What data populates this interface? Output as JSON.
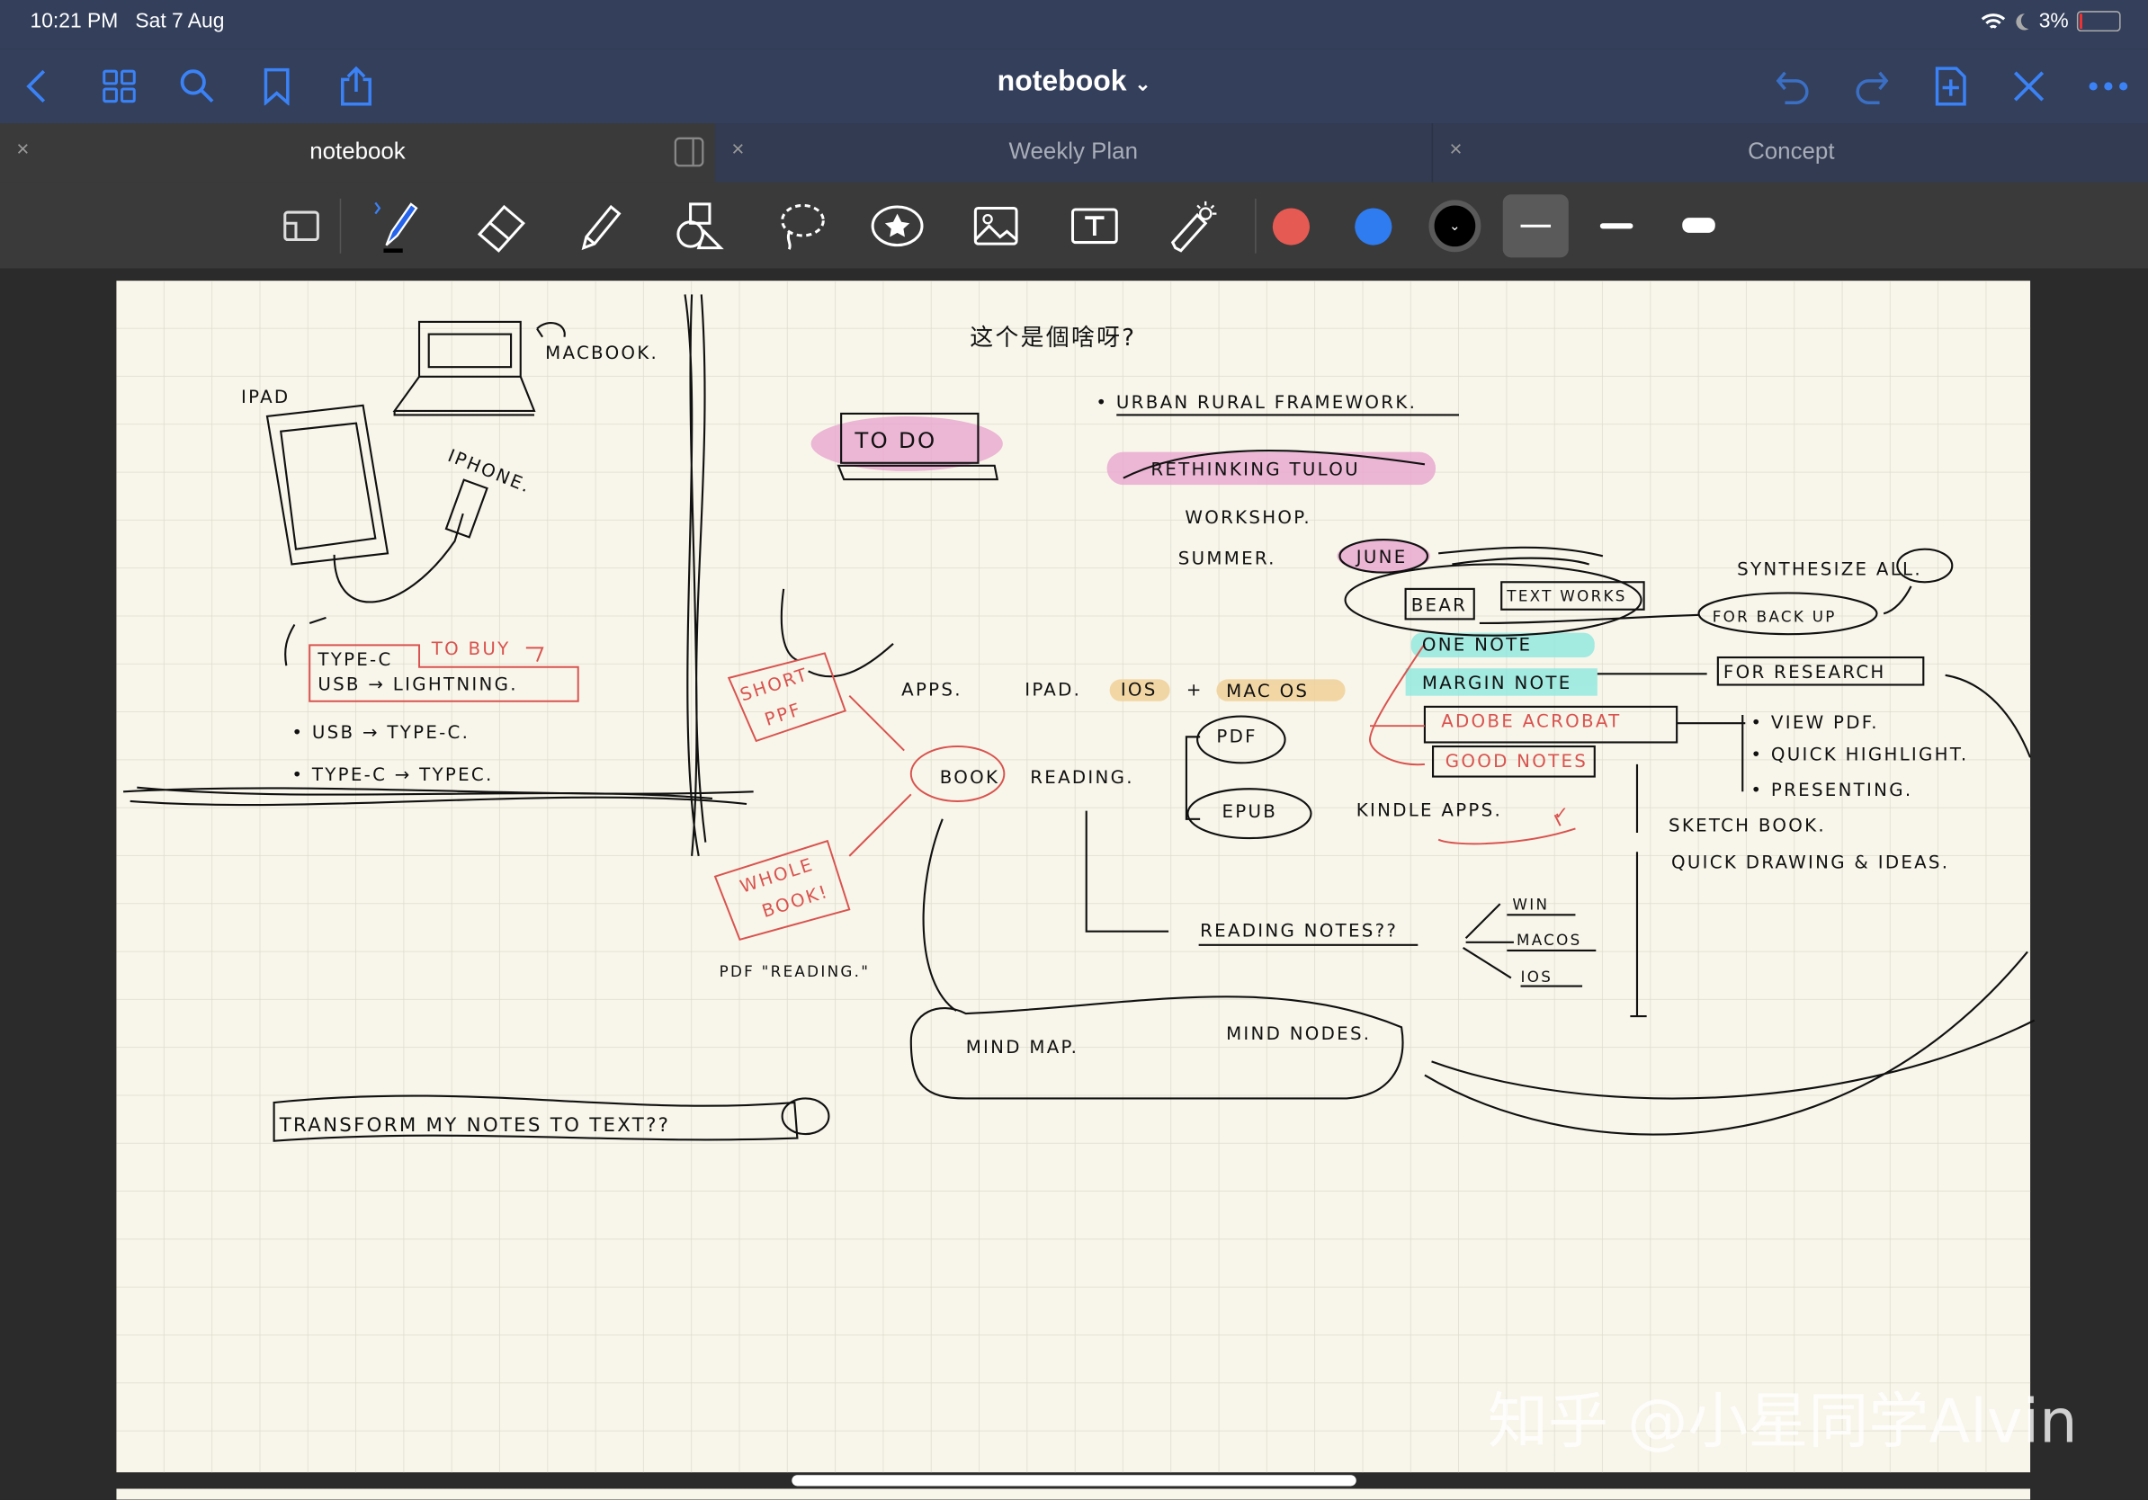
{
  "status_bar": {
    "time": "10:21 PM",
    "date": "Sat 7 Aug",
    "battery": "3%",
    "icons": [
      "wifi-icon",
      "moon-icon",
      "battery-icon"
    ]
  },
  "nav": {
    "title": "notebook",
    "title_chevron": "⌄",
    "left_icons": [
      "back-icon",
      "grid-icon",
      "search-icon",
      "bookmark-icon",
      "share-icon"
    ],
    "right_icons": [
      "undo-icon",
      "redo-icon",
      "add-page-icon",
      "close-toolbar-icon",
      "more-icon"
    ],
    "accent": "#3b82f6"
  },
  "tabs": [
    {
      "label": "notebook",
      "active": true
    },
    {
      "label": "Weekly Plan",
      "active": false
    },
    {
      "label": "Concept",
      "active": false
    }
  ],
  "close_glyph": "×",
  "toolbar": {
    "tools": [
      "zoom-window",
      "pen",
      "eraser",
      "highlighter",
      "shapes",
      "lasso",
      "elements",
      "image",
      "text",
      "laser-pointer"
    ],
    "selected_tool": "pen",
    "colors": [
      "#e55a52",
      "#2f7cf0",
      "#000000"
    ],
    "selected_color": "#000000",
    "stroke_widths": [
      "thin",
      "medium",
      "thick"
    ],
    "selected_width": "thin"
  },
  "notes": {
    "macbook": "MACBOOK.",
    "ipad": "IPAD",
    "iphone": "IPHONE.",
    "type_c": "TYPE-C",
    "to_buy": "TO BUY",
    "usb_lightning": "USB → LIGHTNING.",
    "usb_typec": "• USB → TYPE-C.",
    "typec_typec": "• TYPE-C → TYPEC.",
    "todo": "TO DO",
    "question_cn": "这个是個啥呀?",
    "urban": "• URBAN RURAL FRAMEWORK.",
    "rethinking": "RETHINKING TULOU",
    "workshop": "WORKSHOP.",
    "summer": "SUMMER.",
    "june": "JUNE",
    "bear": "BEAR",
    "text_works": "TEXT WORKS",
    "synthesize": "SYNTHESIZE ALL.",
    "backup": "FOR BACK UP",
    "onenote": "ONE NOTE",
    "marginnote": "MARGIN NOTE",
    "research": "FOR RESEARCH",
    "acrobat": "ADOBE ACROBAT",
    "goodnotes": "GOOD NOTES",
    "view_pdf": "• VIEW PDF.",
    "quick_highlight": "• QUICK HIGHLIGHT.",
    "presenting": "• PRESENTING.",
    "sketch_book": "SKETCH BOOK.",
    "quick_drawing": "QUICK DRAWING & IDEAS.",
    "apps": "APPS.",
    "ipad2": "IPAD.",
    "ios": "IOS",
    "plus": "+",
    "macos": "MAC OS",
    "short": "SHORT",
    "ppf": "PPF",
    "book": "BOOK",
    "reading": "READING.",
    "pdf": "PDF",
    "epub": "EPUB",
    "kindle": "KINDLE APPS.",
    "check": "✓",
    "whole": "WHOLE",
    "book2": "BOOK!",
    "pdf_reading": "PDF \"READING.\"",
    "reading_notes": "READING NOTES??",
    "win": "WIN",
    "macos2": "MACOS",
    "ios2": "IOS",
    "mind_map": "MIND MAP.",
    "mind_nodes": "MIND NODES.",
    "transform": "TRANSFORM MY NOTES TO TEXT??"
  },
  "ink_colors": {
    "black": "#111111",
    "red": "#d9534f",
    "pink_highlight": "#e9a6cf",
    "cyan_highlight": "#8ee8e0",
    "orange_highlight": "#f0cf94"
  },
  "paper": {
    "color": "#f8f6ea",
    "grid": "#dedcce"
  },
  "watermark": "知乎 @小星同学Alvin"
}
